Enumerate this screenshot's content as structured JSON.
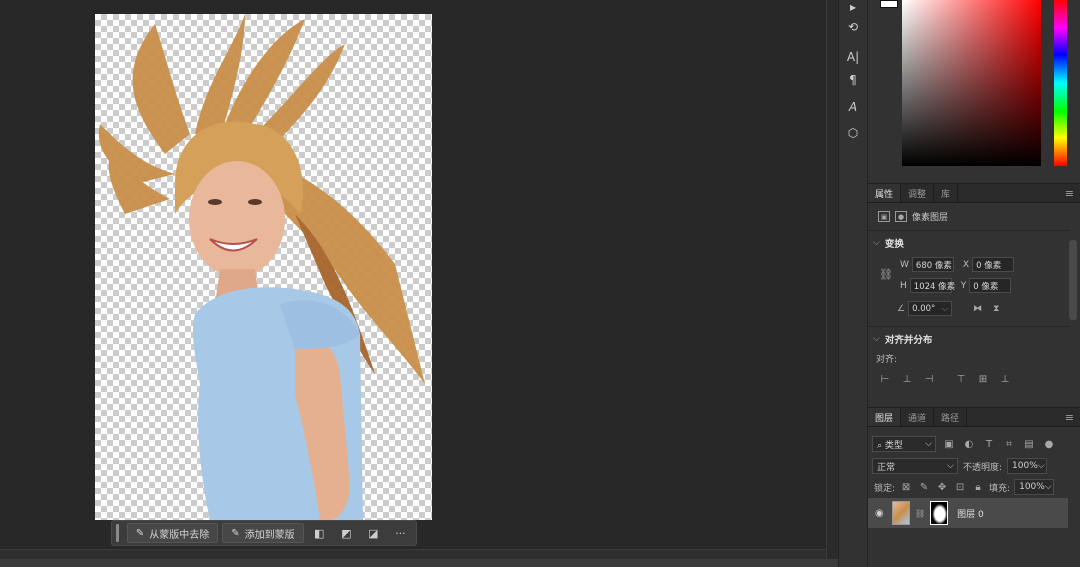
{
  "taskbar": {
    "subtract_label": "从蒙版中去除",
    "add_label": "添加到蒙版",
    "more_label": "···"
  },
  "properties": {
    "tabs": [
      "属性",
      "调整",
      "库"
    ],
    "layer_type": "像素图层",
    "transform_title": "变换",
    "w_label": "W",
    "w_value": "680 像素",
    "h_label": "H",
    "h_value": "1024 像素",
    "x_label": "X",
    "x_value": "0 像素",
    "y_label": "Y",
    "y_value": "0 像素",
    "angle_value": "0.00°",
    "align_title": "对齐并分布",
    "align_label": "对齐:"
  },
  "layers": {
    "tabs": [
      "图层",
      "通道",
      "路径"
    ],
    "filter_label": "类型",
    "blend_mode": "正常",
    "opacity_label": "不透明度:",
    "opacity_value": "100%",
    "lock_label": "锁定:",
    "fill_label": "填充:",
    "fill_value": "100%",
    "layer_name": "图层 0"
  },
  "colors": {
    "canvas_bg": "#282828",
    "panel_bg": "#323232",
    "shirt": "#a8c8e8",
    "hair": "#c98f4a",
    "skin": "#e9b89a"
  },
  "icons": [
    "brush-icon",
    "history-icon",
    "character-icon",
    "paragraph-icon",
    "glyphs-icon",
    "3d-icon",
    "eye-icon",
    "link-icon"
  ]
}
